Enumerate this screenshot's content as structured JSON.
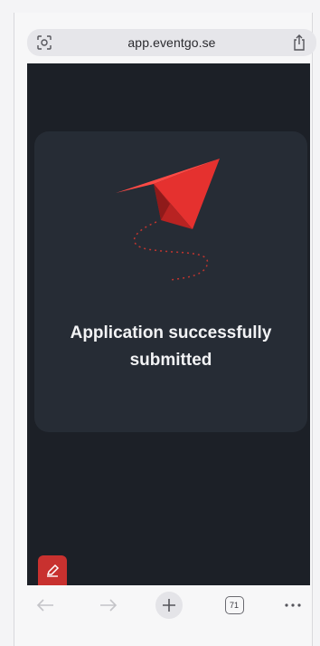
{
  "browser": {
    "url": "app.eventgo.se",
    "tab_count": "71"
  },
  "page": {
    "message": "Application successfully submitted"
  },
  "icons": {
    "address_left": "reader-mode-icon",
    "address_right": "share-icon",
    "plane": "paper-plane-icon",
    "edit": "pencil-icon",
    "back": "back-arrow-icon",
    "forward": "forward-arrow-icon",
    "new_tab": "plus-icon",
    "tabs": "tabs-icon",
    "more": "more-icon"
  },
  "colors": {
    "page_background": "#1c2027",
    "card_background": "#262c35",
    "plane_red": "#e5312f",
    "edit_button": "#c8312f",
    "message_text": "#f2f3f5"
  }
}
